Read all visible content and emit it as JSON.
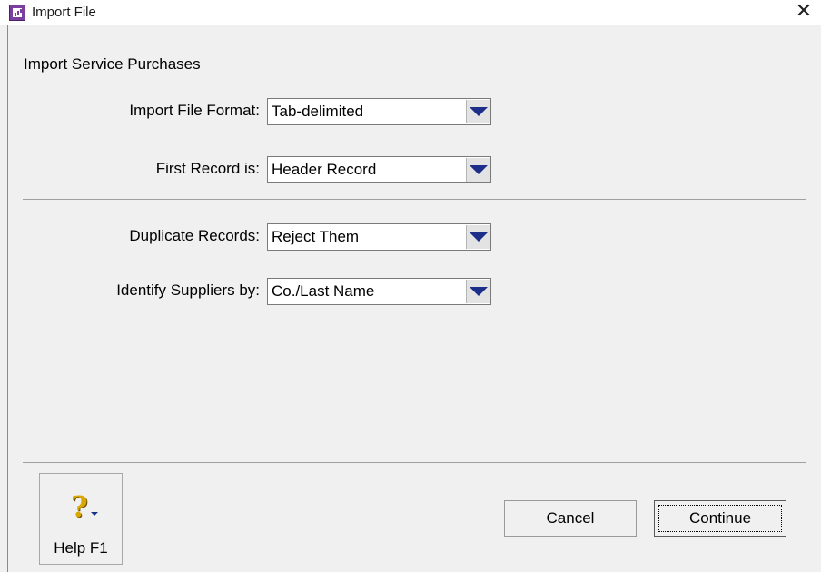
{
  "window": {
    "title": "Import File",
    "close_glyph": "✕"
  },
  "group": {
    "title": "Import Service Purchases"
  },
  "fields": {
    "import_format": {
      "label": "Import File Format:",
      "value": "Tab-delimited"
    },
    "first_record": {
      "label": "First Record is:",
      "value": "Header Record"
    },
    "duplicates": {
      "label": "Duplicate Records:",
      "value": "Reject Them"
    },
    "identify_suppliers": {
      "label": "Identify Suppliers by:",
      "value": "Co./Last Name"
    }
  },
  "buttons": {
    "help_label": "Help F1",
    "help_icon": "?",
    "cancel_label": "Cancel",
    "continue_label": "Continue"
  },
  "colors": {
    "app_icon": "#7b3fa0",
    "dropdown_arrow": "#1d2d8a",
    "help_icon": "#d9a800"
  }
}
